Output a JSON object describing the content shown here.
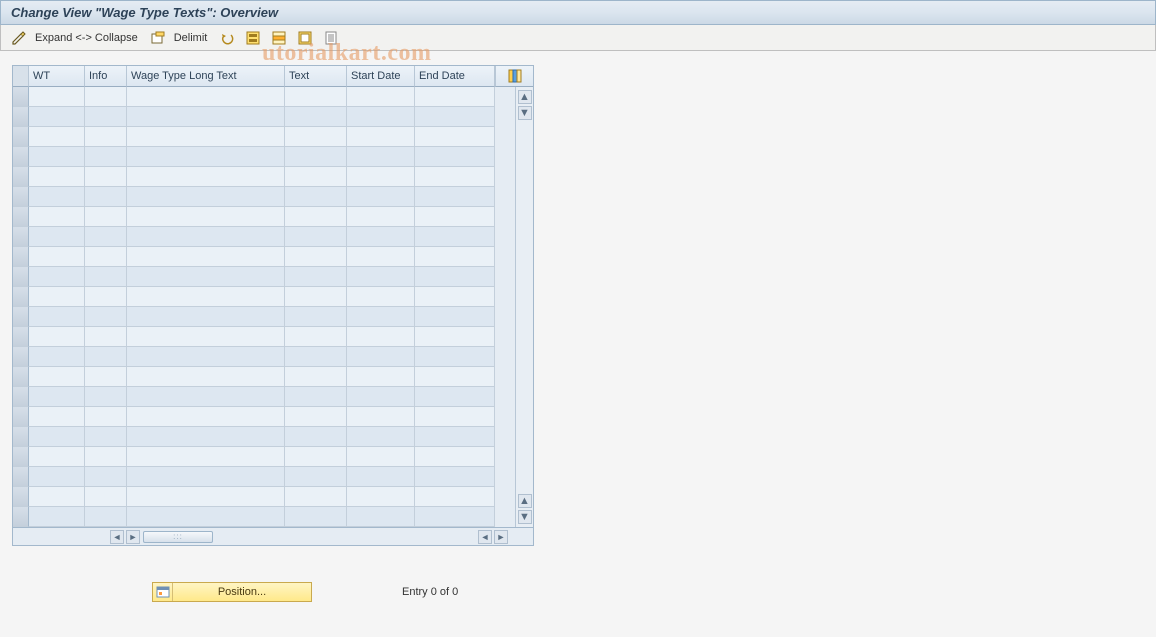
{
  "title": "Change View \"Wage Type Texts\": Overview",
  "toolbar": {
    "expand_collapse": "Expand <-> Collapse",
    "delimit": "Delimit"
  },
  "columns": {
    "wt": "WT",
    "info": "Info",
    "long": "Wage Type Long Text",
    "text": "Text",
    "start": "Start Date",
    "end": "End Date"
  },
  "rows_count": 22,
  "footer": {
    "position_label": "Position...",
    "entry_status": "Entry 0 of 0"
  },
  "watermark": "utorialkart.com"
}
